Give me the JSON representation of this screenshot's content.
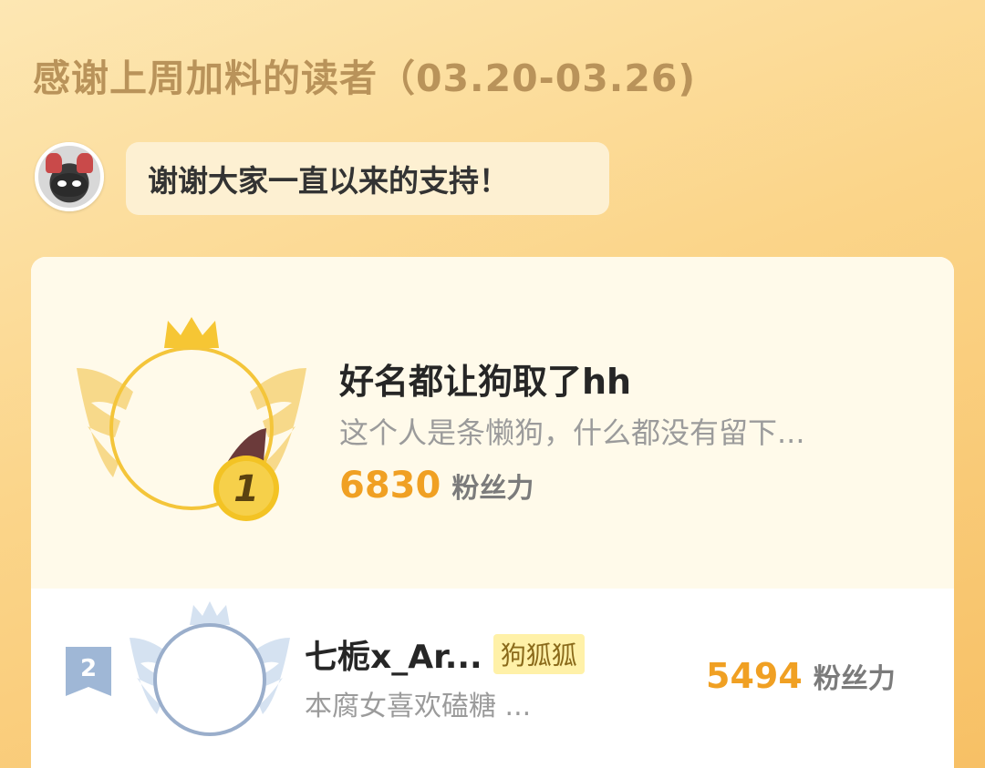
{
  "header": {
    "title": "感谢上周加料的读者（03.20-03.26)"
  },
  "greeting": {
    "avatar_icon": "mascot-avatar-icon",
    "message": "谢谢大家一直以来的支持！"
  },
  "leaderboard": {
    "score_unit": "粉丝力",
    "entries": [
      {
        "rank": "1",
        "name": "好名都让狗取了hh",
        "bio": "这个人是条懒狗，什么都没有留下...",
        "score": "6830"
      },
      {
        "rank": "2",
        "name": "七栀x_Ar...",
        "tag": "狗狐狐",
        "bio": "本腐女喜欢磕糖 ...",
        "score": "5494"
      }
    ]
  },
  "colors": {
    "accent": "#f0a023",
    "title": "#b9935a",
    "gold": "#f3c324",
    "silver": "#9fb7d6"
  }
}
